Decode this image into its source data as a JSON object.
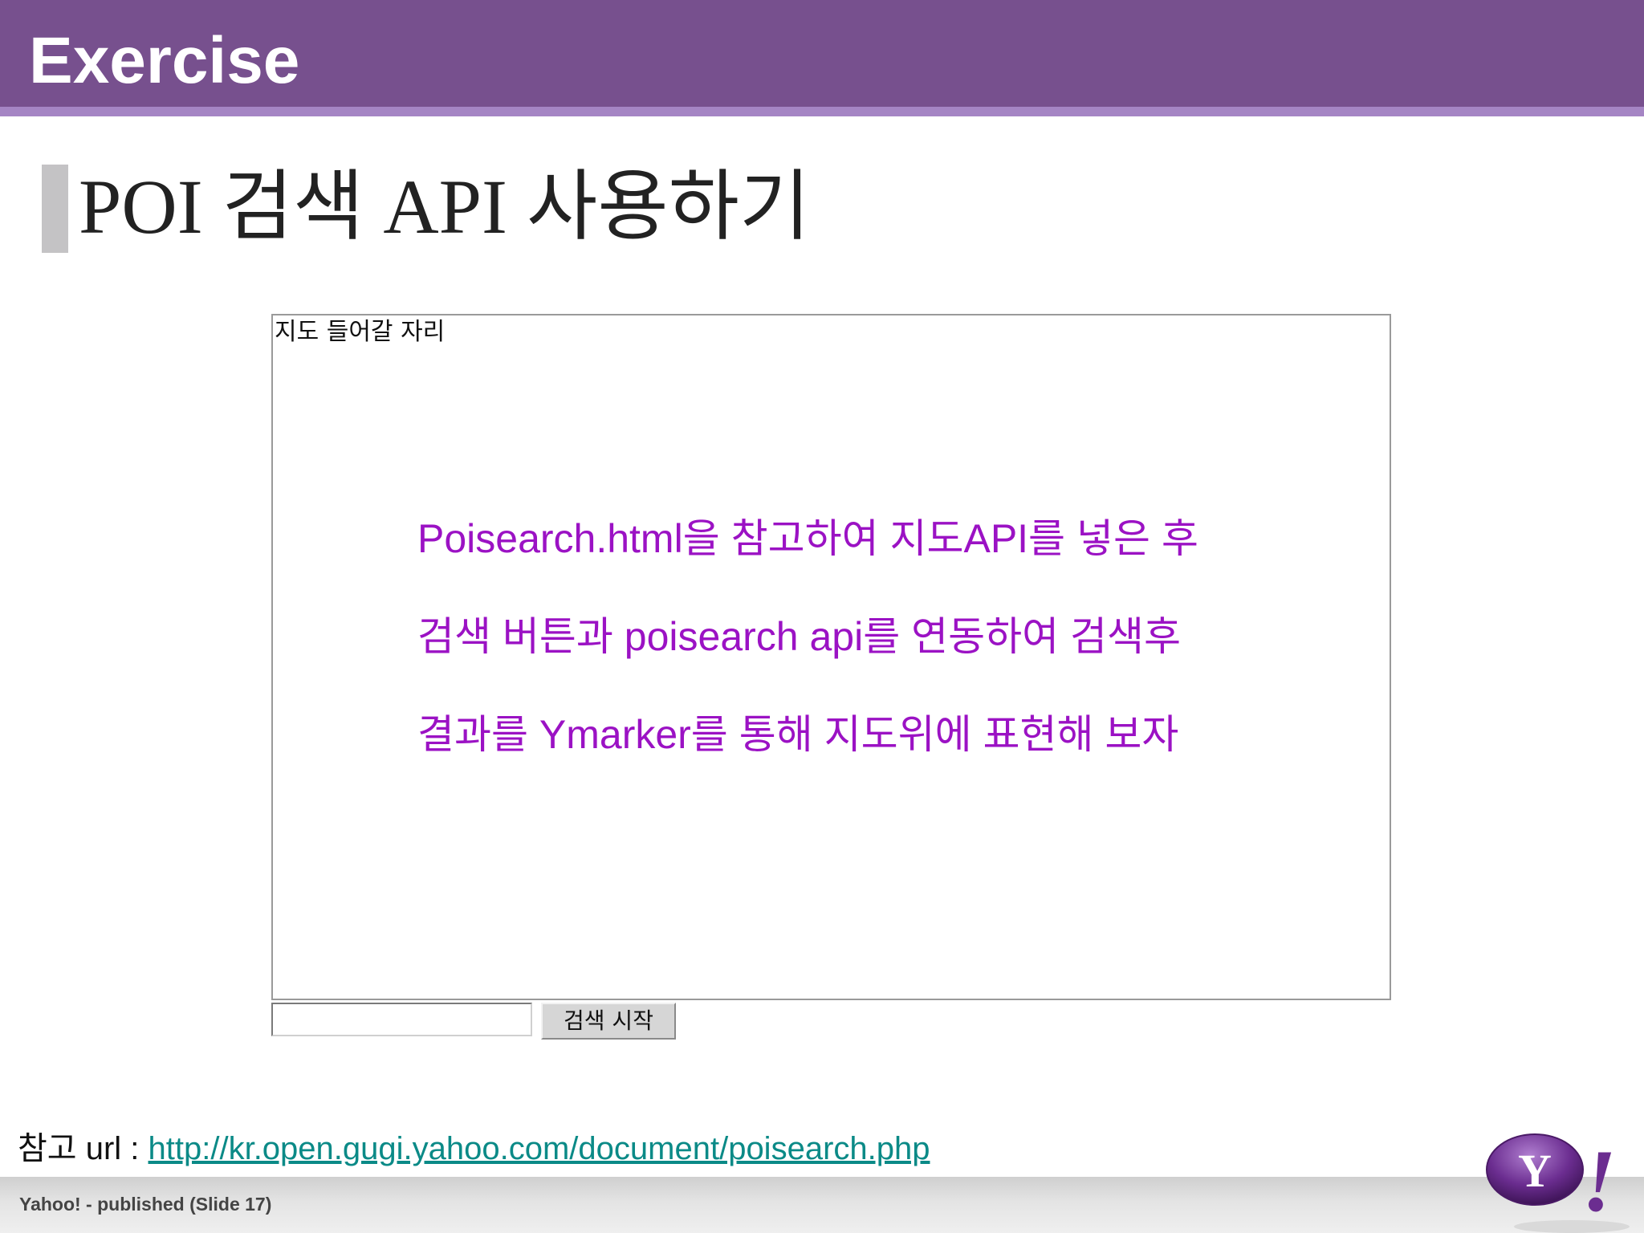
{
  "header": {
    "title": "Exercise"
  },
  "slide": {
    "title": "POI 검색 API 사용하기"
  },
  "map_area": {
    "placeholder": "지도 들어갈 자리",
    "instructions": [
      "Poisearch.html을 참고하여 지도API를 넣은 후",
      "검색 버튼과 poisearch api를 연동하여 검색후",
      "결과를 Ymarker를 통해 지도위에 표현해 보자"
    ]
  },
  "search": {
    "input_value": "",
    "button_label": "검색 시작"
  },
  "reference": {
    "label": "참고 url : ",
    "url": "http://kr.open.gugi.yahoo.com/document/poisearch.php"
  },
  "footer": {
    "text": "Yahoo! - published (Slide 17)"
  },
  "logo": {
    "letter": "Y",
    "mark": "!"
  },
  "colors": {
    "header_bg": "#77508e",
    "header_stripe": "#a585c4",
    "instruction_text": "#9b12c4",
    "link": "#0b8a87",
    "logo_purple": "#6b2d90"
  }
}
